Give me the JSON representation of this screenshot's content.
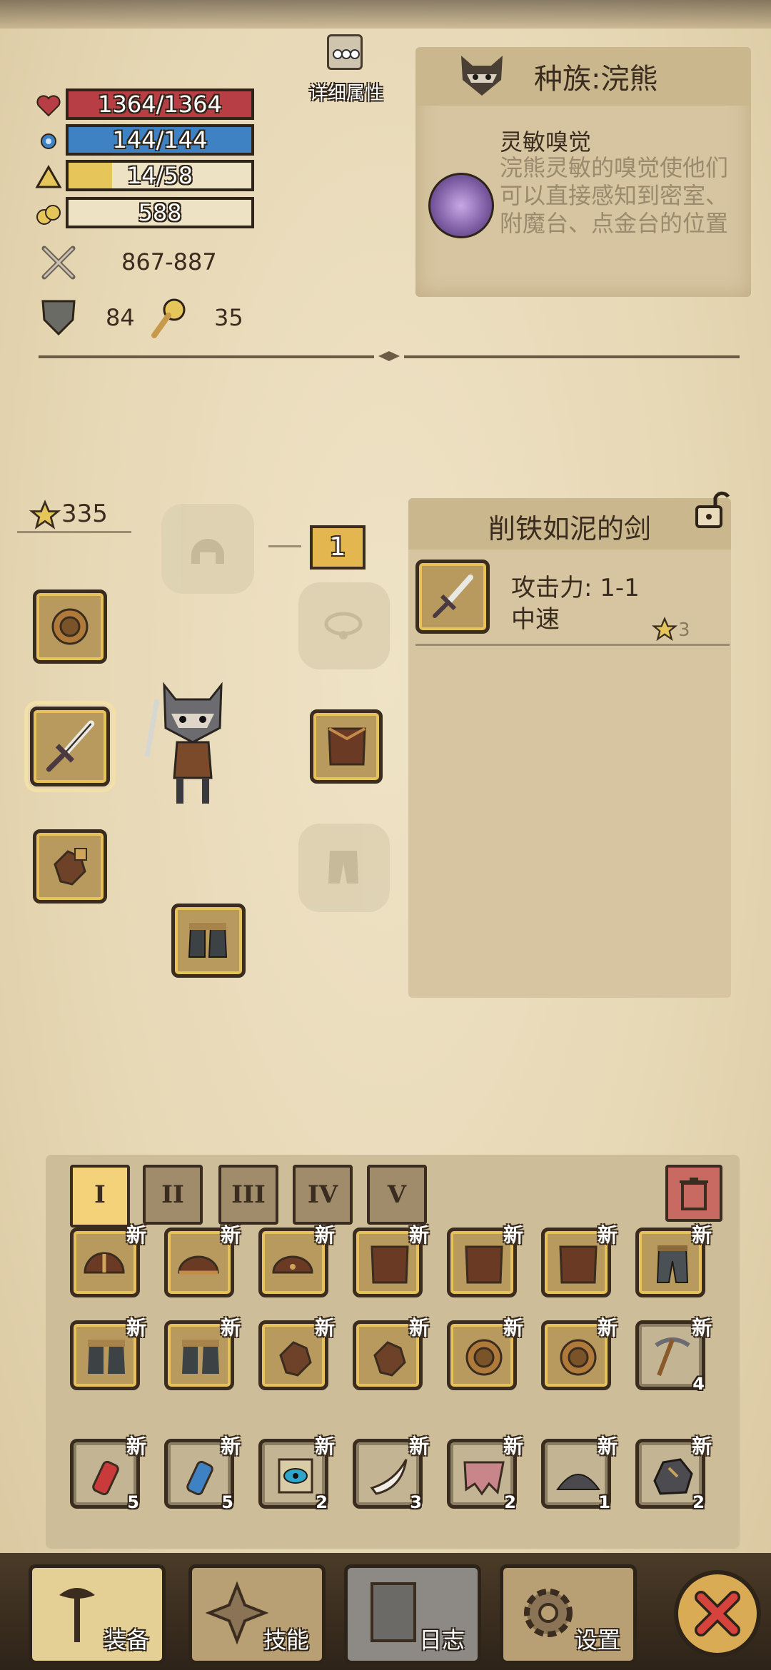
{
  "stats": {
    "hp": {
      "label": "1364/1364",
      "fill": 1.0,
      "color": "#b73e45"
    },
    "mp": {
      "label": "144/144",
      "fill": 1.0,
      "color": "#3f82c4"
    },
    "xp": {
      "label": "14/58",
      "fill": 0.24,
      "color": "#e6c65a"
    },
    "food": {
      "label": "588"
    },
    "attack": "867-887",
    "defense": "84",
    "luck": "35"
  },
  "detail_button": {
    "label": "详细属性"
  },
  "race": {
    "title": "种族:浣熊",
    "ability_title": "灵敏嗅觉",
    "ability_desc": "浣熊灵敏的嗅觉使他们可以直接感知到密室、附魔台、点金台的位置"
  },
  "equipment": {
    "score": "335",
    "level_badge": "1"
  },
  "item_info": {
    "title": "削铁如泥的剑",
    "attack": "攻击力: 1-1",
    "speed": "中速",
    "star_count": "3"
  },
  "inventory": {
    "tabs": [
      "I",
      "II",
      "III",
      "IV",
      "V"
    ],
    "active_tab": 0,
    "new_label": "新",
    "counts": {
      "pickaxe": "4",
      "red_potion": "5",
      "blue_potion": "5",
      "scroll": "2",
      "tooth": "3",
      "wing": "2",
      "powder": "1",
      "ore": "2"
    }
  },
  "nav": {
    "equip": "装备",
    "skills": "技能",
    "log": "日志",
    "settings": "设置"
  },
  "colors": {
    "accent": "#e7c15a",
    "danger": "#c0392b"
  }
}
